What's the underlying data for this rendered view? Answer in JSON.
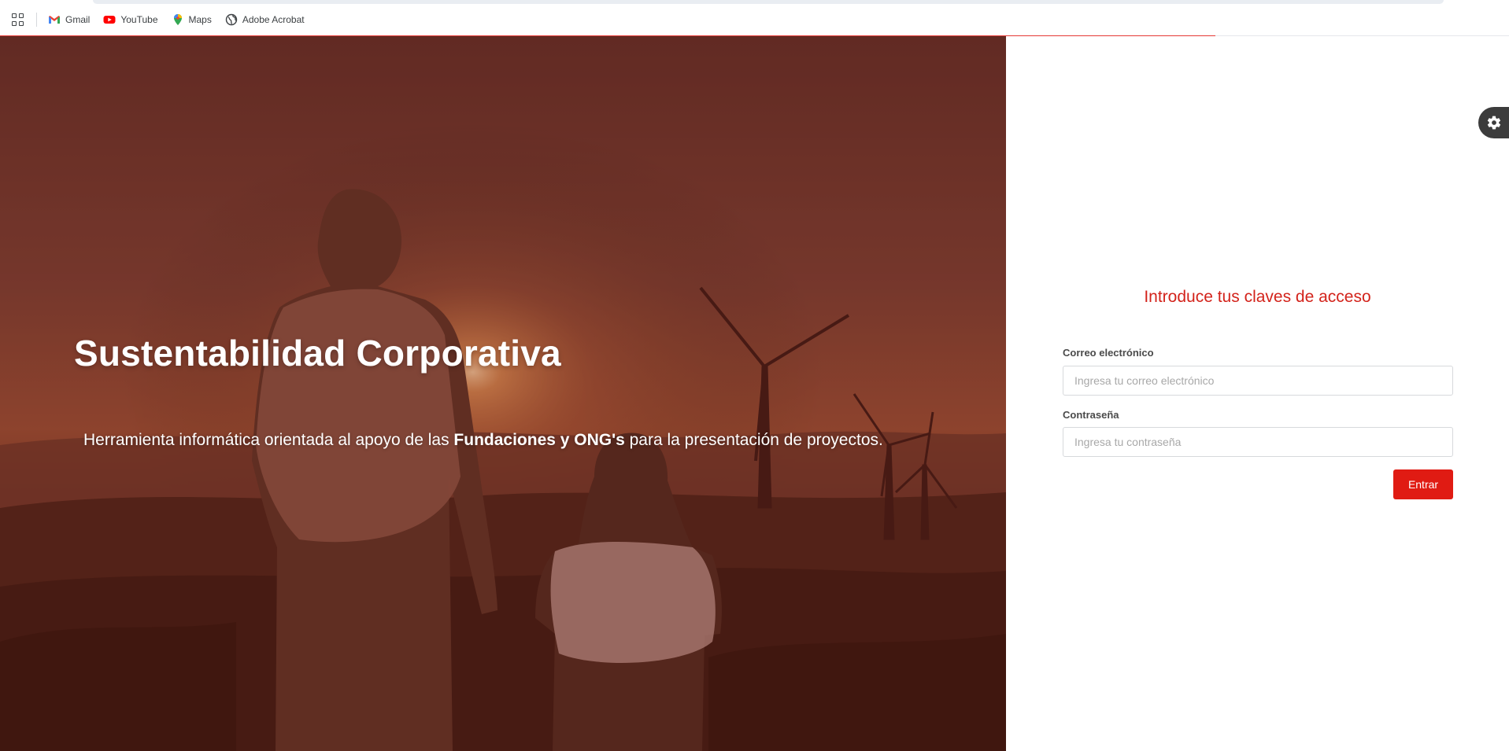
{
  "bookmarks": {
    "items": [
      {
        "label": "Gmail",
        "icon": "gmail-icon"
      },
      {
        "label": "YouTube",
        "icon": "youtube-icon"
      },
      {
        "label": "Maps",
        "icon": "maps-icon"
      },
      {
        "label": "Adobe Acrobat",
        "icon": "globe-icon"
      }
    ]
  },
  "hero": {
    "title": "Sustentabilidad Corporativa",
    "subtitle_before": "Herramienta informática orientada al apoyo de las ",
    "subtitle_bold": "Fundaciones y ONG's",
    "subtitle_after": " para la presentación de proyectos."
  },
  "login": {
    "heading": "Introduce tus claves de acceso",
    "email_label": "Correo electrónico",
    "email_placeholder": "Ingresa tu correo electrónico",
    "password_label": "Contraseña",
    "password_placeholder": "Ingresa tu contraseña",
    "submit_label": "Entrar"
  },
  "colors": {
    "accent": "#e01b13",
    "heading_red": "#d3231b",
    "settings_tab": "#3c3c3c"
  },
  "settings": {
    "icon": "gear-icon"
  }
}
